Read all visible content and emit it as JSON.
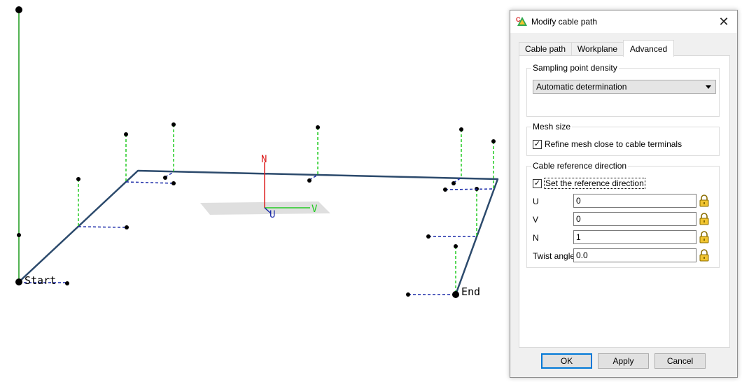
{
  "viewport": {
    "start_label": "Start",
    "end_label": "End",
    "axis_n": "N",
    "axis_v": "V",
    "axis_u": "U"
  },
  "dialog": {
    "title": "Modify cable path",
    "close_glyph": "✕",
    "tabs": [
      {
        "label": "Cable path",
        "active": false
      },
      {
        "label": "Workplane",
        "active": false
      },
      {
        "label": "Advanced",
        "active": true
      }
    ],
    "sampling": {
      "group_title": "Sampling point density",
      "selected": "Automatic determination"
    },
    "mesh": {
      "group_title": "Mesh size",
      "refine_label": "Refine mesh close to cable terminals",
      "refine_checked": true
    },
    "reference": {
      "group_title": "Cable reference direction",
      "set_label": "Set the reference direction",
      "set_checked": true,
      "fields": [
        {
          "label": "U",
          "value": "0"
        },
        {
          "label": "V",
          "value": "0"
        },
        {
          "label": "N",
          "value": "1"
        },
        {
          "label": "Twist angle",
          "value": "0.0"
        }
      ]
    },
    "buttons": {
      "ok": "OK",
      "apply": "Apply",
      "cancel": "Cancel"
    }
  }
}
